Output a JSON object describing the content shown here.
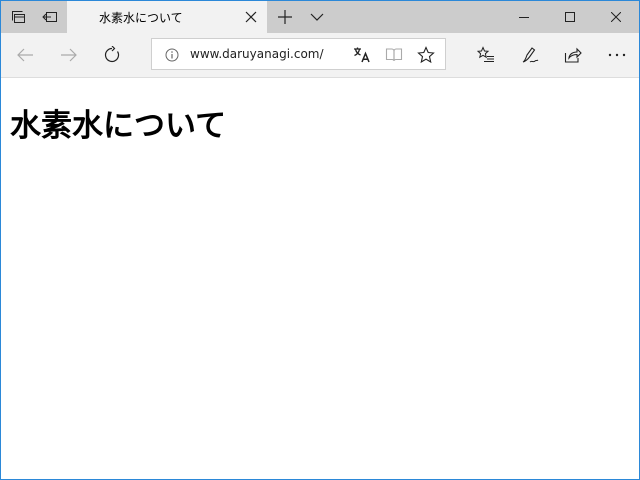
{
  "tab": {
    "title": "水素水について"
  },
  "address_bar": {
    "url": "www.daruyanagi.com/"
  },
  "page": {
    "heading": "水素水について"
  },
  "icons": {
    "tab_preview": "tabs-aside-icon",
    "set_aside": "set-aside-icon",
    "tab_close": "close-icon",
    "new_tab": "plus-icon",
    "tab_list": "chevron-down-icon",
    "minimize": "minimize-icon",
    "maximize": "maximize-icon",
    "window_close": "close-icon",
    "back": "arrow-left-icon",
    "forward": "arrow-right-icon",
    "refresh": "refresh-icon",
    "site_info": "info-icon",
    "translate": "translate-icon",
    "reading_view": "book-icon",
    "favorite": "star-icon",
    "favorites_hub": "favorites-list-icon",
    "web_note": "pen-icon",
    "share": "share-icon",
    "more": "ellipsis-icon"
  }
}
